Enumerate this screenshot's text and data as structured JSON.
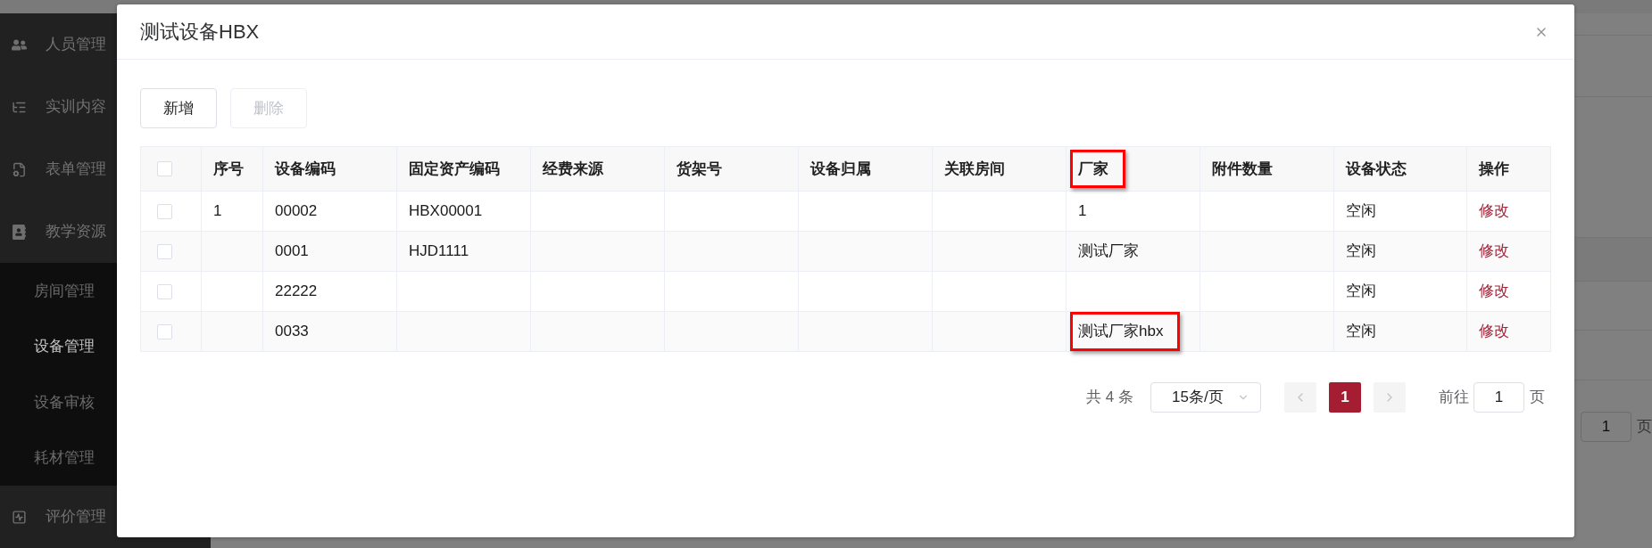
{
  "sidebar": {
    "items": [
      {
        "label": "人员管理"
      },
      {
        "label": "实训内容"
      },
      {
        "label": "表单管理"
      },
      {
        "label": "教学资源",
        "children": [
          {
            "label": "房间管理",
            "selected": false
          },
          {
            "label": "设备管理",
            "selected": true
          },
          {
            "label": "设备审核",
            "selected": false
          },
          {
            "label": "耗材管理",
            "selected": false
          }
        ]
      },
      {
        "label": "评价管理"
      }
    ]
  },
  "background_page": {
    "goto_value": "1",
    "goto_suffix": "页"
  },
  "dialog": {
    "title": "测试设备HBX",
    "toolbar": [
      {
        "label": "新增",
        "disabled": false
      },
      {
        "label": "删除",
        "disabled": true
      }
    ],
    "table": {
      "select_all": {
        "checked": false
      },
      "columns": [
        {
          "label": "序号",
          "highlighted": false
        },
        {
          "label": "设备编码",
          "highlighted": false
        },
        {
          "label": "固定资产编码",
          "highlighted": false
        },
        {
          "label": "经费来源",
          "highlighted": false
        },
        {
          "label": "货架号",
          "highlighted": false
        },
        {
          "label": "设备归属",
          "highlighted": false
        },
        {
          "label": "关联房间",
          "highlighted": false
        },
        {
          "label": "厂家",
          "highlighted": true
        },
        {
          "label": "附件数量",
          "highlighted": false
        },
        {
          "label": "设备状态",
          "highlighted": false
        },
        {
          "label": "操作",
          "highlighted": false
        }
      ],
      "rows": [
        {
          "checked": false,
          "cells": [
            {
              "kind": "text",
              "text": "1",
              "highlighted": false
            },
            {
              "kind": "text",
              "text": "00002",
              "highlighted": false
            },
            {
              "kind": "text",
              "text": "HBX00001",
              "highlighted": false
            },
            null,
            null,
            null,
            null,
            {
              "kind": "text",
              "text": "1",
              "highlighted": false
            },
            null,
            {
              "kind": "text",
              "text": "空闲",
              "highlighted": false
            },
            {
              "kind": "link",
              "text": "修改",
              "highlighted": false
            }
          ]
        },
        {
          "checked": false,
          "cells": [
            null,
            {
              "kind": "text",
              "text": "0001",
              "highlighted": false
            },
            {
              "kind": "text",
              "text": "HJD1111",
              "highlighted": false
            },
            null,
            null,
            null,
            null,
            {
              "kind": "text",
              "text": "测试厂家",
              "highlighted": false
            },
            null,
            {
              "kind": "text",
              "text": "空闲",
              "highlighted": false
            },
            {
              "kind": "link",
              "text": "修改",
              "highlighted": false
            }
          ]
        },
        {
          "checked": false,
          "cells": [
            null,
            {
              "kind": "text",
              "text": "22222",
              "highlighted": false
            },
            null,
            null,
            null,
            null,
            null,
            null,
            null,
            {
              "kind": "text",
              "text": "空闲",
              "highlighted": false
            },
            {
              "kind": "link",
              "text": "修改",
              "highlighted": false
            }
          ]
        },
        {
          "checked": false,
          "cells": [
            null,
            {
              "kind": "text",
              "text": "0033",
              "highlighted": false
            },
            null,
            null,
            null,
            null,
            null,
            {
              "kind": "text",
              "text": "测试厂家hbx",
              "highlighted": true
            },
            null,
            {
              "kind": "text",
              "text": "空闲",
              "highlighted": false
            },
            {
              "kind": "link",
              "text": "修改",
              "highlighted": false
            }
          ]
        }
      ]
    },
    "pagination": {
      "total": "共 4 条",
      "page_size": "15条/页",
      "prev_disabled": true,
      "pages": [
        {
          "label": "1",
          "selected": true
        }
      ],
      "next_disabled": true,
      "goto_label": "前往",
      "goto_value": "1",
      "goto_suffix": "页"
    }
  }
}
